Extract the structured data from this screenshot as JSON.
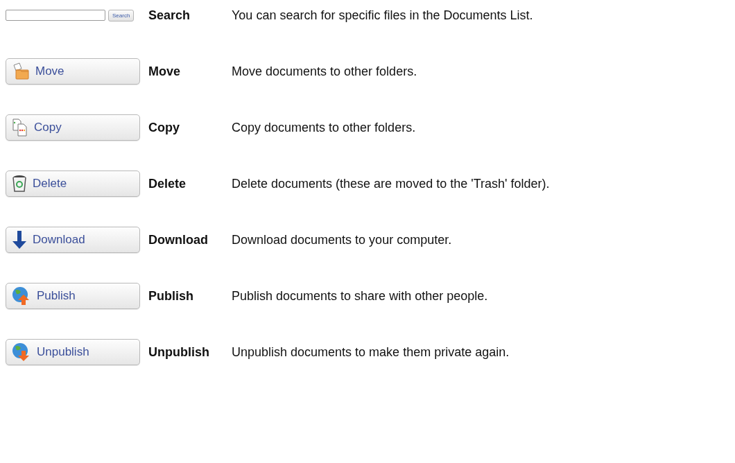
{
  "rows": [
    {
      "kind": "search",
      "search_button": "Search",
      "term": "Search",
      "description": "You can search for specific files in the Documents List."
    },
    {
      "kind": "move",
      "button": "Move",
      "term": "Move",
      "description": "Move documents to other folders."
    },
    {
      "kind": "copy",
      "button": "Copy",
      "term": "Copy",
      "description": "Copy documents to other folders."
    },
    {
      "kind": "delete",
      "button": "Delete",
      "term": "Delete",
      "description": "Delete documents (these are moved to the 'Trash' folder)."
    },
    {
      "kind": "download",
      "button": "Download",
      "term": "Download",
      "description": "Download documents to your computer."
    },
    {
      "kind": "publish",
      "button": "Publish",
      "term": "Publish",
      "description": "Publish documents to share with other people."
    },
    {
      "kind": "unpublish",
      "button": "Unpublish",
      "term": "Unpublish",
      "description": "Unpublish documents to make them private again."
    }
  ]
}
